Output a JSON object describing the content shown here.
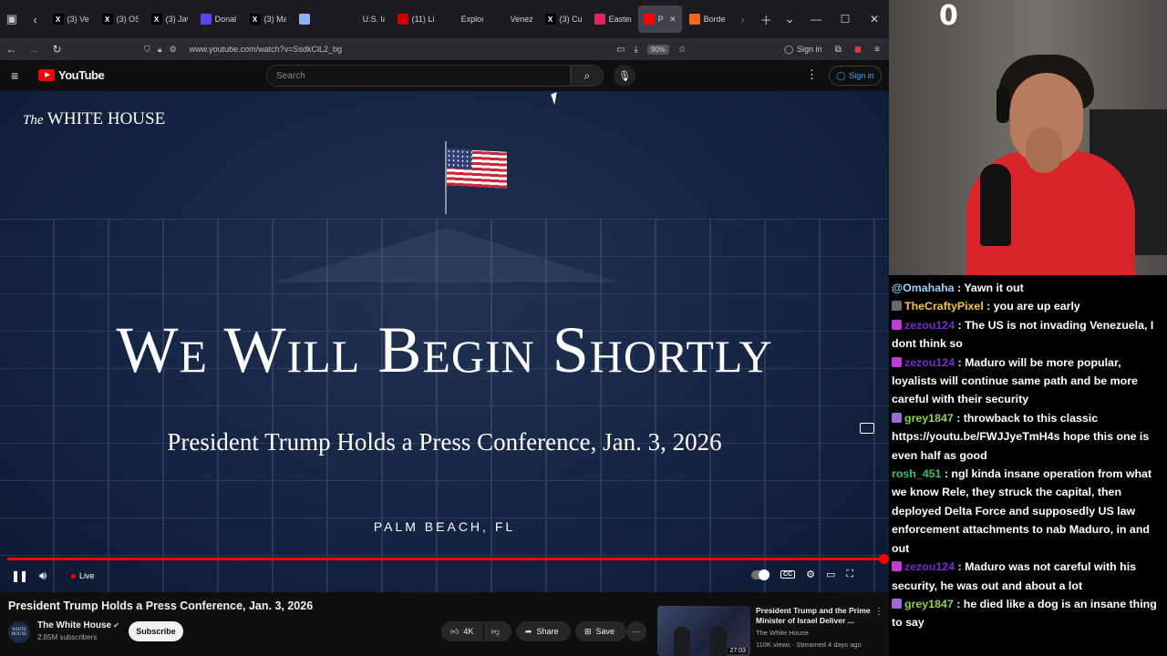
{
  "browser": {
    "tabs": [
      {
        "label": "(3) Ve",
        "icon": "x-icon",
        "color": "#000000"
      },
      {
        "label": "(3) OS",
        "icon": "x-icon",
        "color": "#000000"
      },
      {
        "label": "(3) Jav",
        "icon": "x-icon",
        "color": "#000000"
      },
      {
        "label": "Donal",
        "icon": "truth-icon",
        "color": "#5448ee"
      },
      {
        "label": "(3) Ma",
        "icon": "x-icon",
        "color": "#000000"
      },
      {
        "label": "",
        "icon": "blank-icon",
        "color": "#8ab4f8"
      },
      {
        "label": "U.S. la",
        "icon": "page-icon",
        "color": "#1c1b22"
      },
      {
        "label": "(11) Li",
        "icon": "cnn-icon",
        "color": "#cc0000"
      },
      {
        "label": "Explor",
        "icon": "explore-icon",
        "color": "#1c1b22"
      },
      {
        "label": "Venez",
        "icon": "chat-icon",
        "color": "#1c1b22"
      },
      {
        "label": "(3) Cu",
        "icon": "x-icon",
        "color": "#000000"
      },
      {
        "label": "Easter",
        "icon": "bookmark-icon",
        "color": "#e0245e"
      },
      {
        "label": "Pre",
        "icon": "youtube-icon",
        "color": "#ff0000",
        "active": true
      },
      {
        "label": "Borde",
        "icon": "orange-icon",
        "color": "#f06a1d"
      }
    ],
    "url": "www.youtube.com/watch?v=SsdkClL2_bg",
    "zoom": "90%",
    "sign_in": "Sign in"
  },
  "youtube": {
    "logo_text": "YouTube",
    "search_placeholder": "Search",
    "sign_in": "Sign in"
  },
  "video": {
    "brand": "The WHITE HOUSE",
    "brand_the": "The",
    "brand_wh": "WHITE HOUSE",
    "headline": "We Will Begin Shortly",
    "subtitle": "President Trump Holds a Press Conference, Jan. 3, 2026",
    "location": "PALM BEACH, FL",
    "live_label": "Live",
    "progress": 1.0
  },
  "below": {
    "title": "President Trump Holds a Press Conference, Jan. 3, 2026",
    "channel": "The White House",
    "subscribers": "2.85M subscribers",
    "avatar_text": "WHITE HOUSE",
    "subscribe": "Subscribe",
    "likes": "4K",
    "share": "Share",
    "save": "Save",
    "rec_title": "President Trump and the Prime Minister of Israel Deliver ...",
    "rec_channel": "The White House",
    "rec_meta": "110K views · Streamed 4 days ago",
    "rec_duration": "27:03"
  },
  "overlay": {
    "counter": "0"
  },
  "chat": [
    {
      "user": "@Omahaha",
      "text": " : Yawn it out",
      "user_color": "#9ad1ff",
      "badge": ""
    },
    {
      "user": "TheCraftyPixel",
      "text": " : you are up early",
      "user_color": "#f5c542",
      "badge": "#6b6b6b"
    },
    {
      "user": "zezou124",
      "text": " : The US is not invading Venezuela, I dont think so",
      "user_color": "#7a2bcf",
      "badge": "#c13bd6"
    },
    {
      "user": "zezou124",
      "text": " : Maduro will be more popular, loyalists will continue same path and be more careful with their security",
      "user_color": "#7a2bcf",
      "badge": "#c13bd6"
    },
    {
      "user": "grey1847",
      "text": " : throwback to this classic https://youtu.be/FWJJyeTmH4s hope this one is even half as good",
      "user_color": "#8fd14f",
      "badge": "#9f6ad6"
    },
    {
      "user": "rosh_451",
      "text": " : ngl kinda insane operation from what we know Rele, they struck the capital, then deployed Delta Force and supposedly US law enforcement attachments to nab Maduro, in and out",
      "user_color": "#35c46b",
      "badge": ""
    },
    {
      "user": "zezou124",
      "text": " : Maduro was not careful with his security, he was out and about a lot",
      "user_color": "#7a2bcf",
      "badge": "#c13bd6"
    },
    {
      "user": "grey1847",
      "text": " : he died like a dog is an insane thing to say",
      "user_color": "#8fd14f",
      "badge": "#9f6ad6"
    }
  ]
}
